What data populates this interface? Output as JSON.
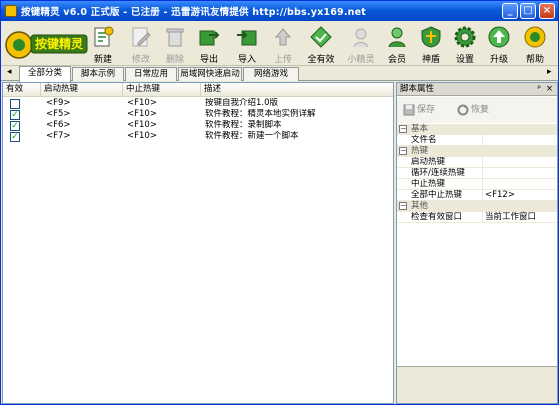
{
  "window": {
    "title": "按键精灵 v6.0 正式版 - 已注册 - 迅雷游讯友情提供 http://bbs.yx169.net",
    "minimize": "_",
    "maximize": "□",
    "close": "×"
  },
  "toolbar": {
    "logo_text": "按键精灵",
    "buttons": [
      {
        "label": "新建",
        "icon": "new-script-icon",
        "enabled": true
      },
      {
        "label": "修改",
        "icon": "edit-icon",
        "enabled": false
      },
      {
        "label": "删除",
        "icon": "trash-icon",
        "enabled": false
      },
      {
        "label": "导出",
        "icon": "export-icon",
        "enabled": true
      },
      {
        "label": "导入",
        "icon": "import-icon",
        "enabled": true
      },
      {
        "label": "上传",
        "icon": "upload-icon",
        "enabled": false
      },
      {
        "label": "全有效",
        "icon": "all-valid-icon",
        "enabled": true
      },
      {
        "label": "小精灵",
        "icon": "wizard-icon",
        "enabled": false
      },
      {
        "label": "会员",
        "icon": "member-icon",
        "enabled": true
      },
      {
        "label": "神盾",
        "icon": "shield-icon",
        "enabled": true
      },
      {
        "label": "设置",
        "icon": "gear-icon",
        "enabled": true
      },
      {
        "label": "升级",
        "icon": "upgrade-icon",
        "enabled": true
      },
      {
        "label": "帮助",
        "icon": "help-icon",
        "enabled": true
      }
    ],
    "colors": {
      "accent": "#2a8a2a",
      "logo_bg": "#3a7a1a"
    }
  },
  "tabs": {
    "prev": "◂",
    "next": "▸",
    "items": [
      {
        "label": "全部分类",
        "active": true
      },
      {
        "label": "脚本示例",
        "active": false
      },
      {
        "label": "日常应用",
        "active": false
      },
      {
        "label": "局域网快速启动",
        "active": false
      },
      {
        "label": "网络游戏",
        "active": false
      }
    ]
  },
  "list": {
    "columns": [
      "有效",
      "启动热键",
      "中止热键",
      "描述"
    ],
    "rows": [
      {
        "checked": false,
        "start": "<F9>",
        "stop": "<F10>",
        "desc": "按键自我介绍1.0版"
      },
      {
        "checked": true,
        "start": "<F5>",
        "stop": "<F10>",
        "desc": "软件教程：精灵本地实例详解"
      },
      {
        "checked": true,
        "start": "<F6>",
        "stop": "<F10>",
        "desc": "软件教程：录制脚本"
      },
      {
        "checked": true,
        "start": "<F7>",
        "stop": "<F10>",
        "desc": "软件教程：新建一个脚本"
      }
    ]
  },
  "properties": {
    "title": "脚本属性",
    "pin": "ᵖ",
    "close": "×",
    "save_label": "保存",
    "restore_label": "恢复",
    "categories": [
      {
        "label": "基本",
        "items": [
          {
            "key": "文件名",
            "value": ""
          }
        ]
      },
      {
        "label": "热键",
        "items": [
          {
            "key": "启动热键",
            "value": ""
          },
          {
            "key": "循环/连续热键",
            "value": ""
          },
          {
            "key": "中止热键",
            "value": ""
          },
          {
            "key": "全部中止热键",
            "value": "<F12>"
          }
        ]
      },
      {
        "label": "其他",
        "items": [
          {
            "key": "检查有效窗口",
            "value": "当前工作窗口"
          }
        ]
      }
    ]
  }
}
